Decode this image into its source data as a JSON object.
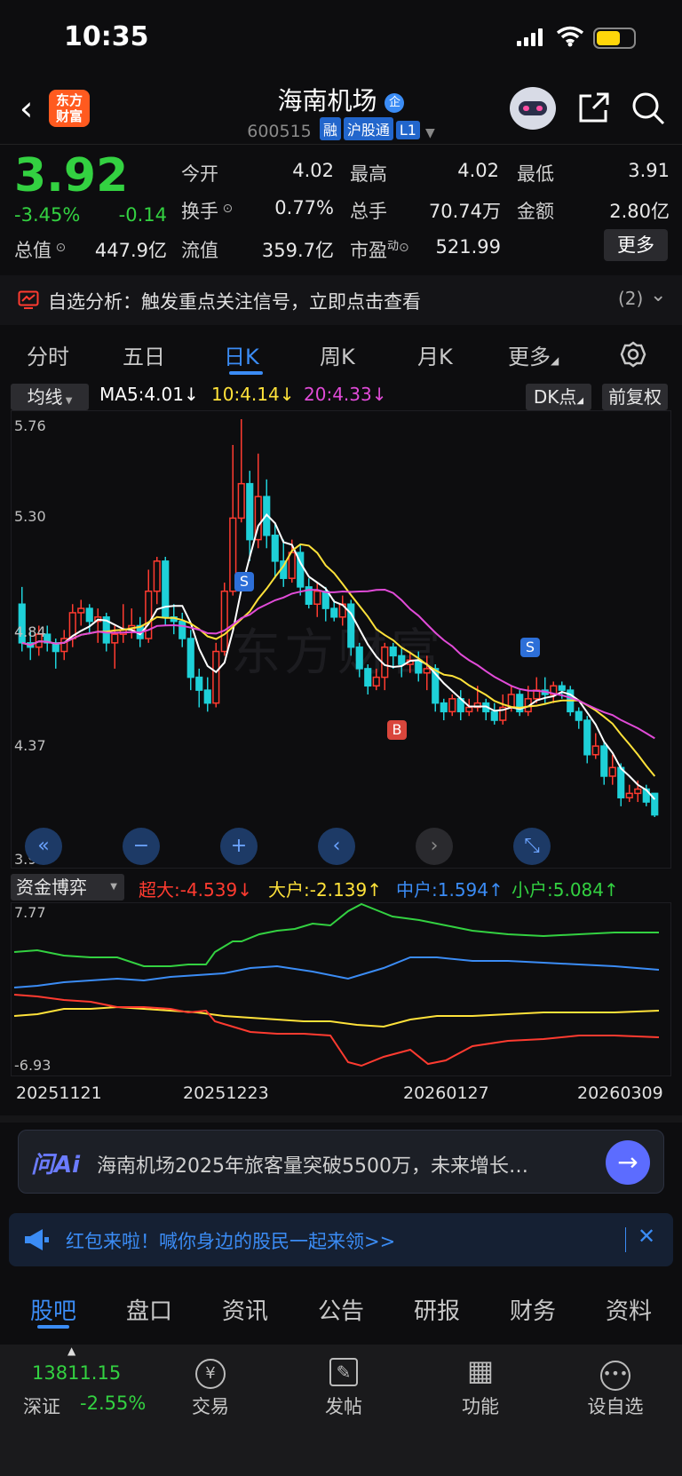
{
  "status_bar": {
    "time": "10:35"
  },
  "header": {
    "title": "海南机场",
    "title_badge": "企",
    "code": "600515",
    "tags": [
      "融",
      "沪股通",
      "L1"
    ],
    "logo_line1": "东方",
    "logo_line2": "财富"
  },
  "quote": {
    "price": "3.92",
    "change_pct": "-3.45%",
    "change": "-0.14",
    "fields": {
      "open_label": "今开",
      "open": "4.02",
      "high_label": "最高",
      "high": "4.02",
      "low_label": "最低",
      "low": "3.91",
      "turnover_label": "换手",
      "turnover": "0.77%",
      "volume_label": "总手",
      "volume": "70.74万",
      "amount_label": "金额",
      "amount": "2.80亿",
      "mcap_label": "总值",
      "mcap": "447.9亿",
      "float_label": "流值",
      "float": "359.7亿",
      "pe_label": "市盈",
      "pe_sup": "动",
      "pe": "521.99"
    },
    "more_label": "更多"
  },
  "banner": {
    "text": "自选分析：触发重点关注信号，立即点击查看",
    "count": "(2)"
  },
  "chart_tabs": [
    "分时",
    "五日",
    "日K",
    "周K",
    "月K",
    "更多"
  ],
  "active_tab": "日K",
  "ma_bar": {
    "selector": "均线",
    "ma5": "MA5:4.01",
    "ma10": "10:4.14",
    "ma20": "20:4.33",
    "dk_label": "DK点",
    "adjust_label": "前复权"
  },
  "price_axis": [
    "5.76",
    "5.30",
    "4.84",
    "4.37",
    "3.91"
  ],
  "markers": {
    "s1": "S",
    "s2": "S",
    "b1": "B"
  },
  "watermark": "东方财富",
  "fund_bar": {
    "selector": "资金博弈",
    "super": "超大:-4.539",
    "large": "大户:-2.139",
    "medium": "中户:1.594",
    "small": "小户:5.084"
  },
  "fund_axis": [
    "7.77",
    "-6.93"
  ],
  "dates": [
    "20251121",
    "20251223",
    "20260127",
    "20260309"
  ],
  "ai": {
    "logo": "问Ai",
    "text": "海南机场2025年旅客量突破5500万，未来增长…"
  },
  "promo": {
    "text": "红包来啦！喊你身边的股民一起来领>>"
  },
  "bottom_tabs": [
    "股吧",
    "盘口",
    "资讯",
    "公告",
    "研报",
    "财务",
    "资料"
  ],
  "bottom_bar": {
    "index_value": "13811.15",
    "index_name": "深证",
    "index_change": "-2.55%",
    "items": [
      "交易",
      "发帖",
      "功能",
      "设自选"
    ]
  },
  "chart_data": {
    "type": "candlestick",
    "ylim": [
      3.91,
      5.76
    ],
    "candles": [
      [
        4.9,
        4.72,
        4.98,
        4.68
      ],
      [
        4.72,
        4.7,
        4.78,
        4.64
      ],
      [
        4.7,
        4.76,
        4.8,
        4.66
      ],
      [
        4.76,
        4.72,
        4.8,
        4.68
      ],
      [
        4.72,
        4.68,
        4.74,
        4.6
      ],
      [
        4.68,
        4.74,
        4.78,
        4.64
      ],
      [
        4.74,
        4.86,
        4.9,
        4.7
      ],
      [
        4.86,
        4.88,
        4.92,
        4.8
      ],
      [
        4.88,
        4.82,
        4.9,
        4.76
      ],
      [
        4.82,
        4.84,
        4.88,
        4.72
      ],
      [
        4.84,
        4.72,
        4.86,
        4.68
      ],
      [
        4.72,
        4.76,
        4.8,
        4.6
      ],
      [
        4.76,
        4.78,
        4.9,
        4.72
      ],
      [
        4.78,
        4.8,
        4.88,
        4.74
      ],
      [
        4.8,
        4.74,
        4.84,
        4.7
      ],
      [
        4.74,
        4.96,
        5.06,
        4.72
      ],
      [
        4.96,
        5.1,
        5.12,
        4.9
      ],
      [
        5.1,
        4.84,
        5.12,
        4.8
      ],
      [
        4.84,
        4.82,
        4.9,
        4.76
      ],
      [
        4.82,
        4.74,
        4.86,
        4.7
      ],
      [
        4.74,
        4.56,
        4.78,
        4.5
      ],
      [
        4.56,
        4.5,
        4.6,
        4.42
      ],
      [
        4.5,
        4.44,
        4.56,
        4.4
      ],
      [
        4.44,
        4.68,
        4.72,
        4.42
      ],
      [
        4.68,
        4.96,
        5.0,
        4.66
      ],
      [
        4.96,
        5.3,
        5.64,
        4.94
      ],
      [
        5.3,
        5.46,
        5.76,
        5.28
      ],
      [
        5.46,
        5.2,
        5.52,
        5.1
      ],
      [
        5.2,
        5.4,
        5.6,
        5.16
      ],
      [
        5.4,
        5.22,
        5.48,
        5.16
      ],
      [
        5.22,
        5.1,
        5.28,
        5.02
      ],
      [
        5.1,
        5.02,
        5.2,
        4.98
      ],
      [
        5.02,
        5.14,
        5.2,
        5.0
      ],
      [
        5.14,
        4.98,
        5.18,
        4.94
      ],
      [
        4.98,
        4.9,
        5.02,
        4.88
      ],
      [
        4.9,
        4.96,
        5.0,
        4.84
      ],
      [
        4.96,
        4.88,
        4.98,
        4.82
      ],
      [
        4.88,
        4.84,
        4.92,
        4.82
      ],
      [
        4.84,
        4.9,
        4.94,
        4.8
      ],
      [
        4.9,
        4.7,
        4.92,
        4.66
      ],
      [
        4.7,
        4.6,
        4.72,
        4.56
      ],
      [
        4.6,
        4.52,
        4.62,
        4.48
      ],
      [
        4.52,
        4.56,
        4.6,
        4.5
      ],
      [
        4.56,
        4.7,
        4.72,
        4.5
      ],
      [
        4.7,
        4.66,
        4.72,
        4.6
      ],
      [
        4.66,
        4.62,
        4.7,
        4.56
      ],
      [
        4.62,
        4.64,
        4.68,
        4.58
      ],
      [
        4.64,
        4.58,
        4.68,
        4.54
      ],
      [
        4.58,
        4.6,
        4.66,
        4.5
      ],
      [
        4.6,
        4.44,
        4.62,
        4.4
      ],
      [
        4.44,
        4.4,
        4.46,
        4.36
      ],
      [
        4.4,
        4.46,
        4.48,
        4.38
      ],
      [
        4.46,
        4.4,
        4.5,
        4.36
      ],
      [
        4.4,
        4.42,
        4.46,
        4.38
      ],
      [
        4.42,
        4.44,
        4.52,
        4.4
      ],
      [
        4.44,
        4.4,
        4.46,
        4.36
      ],
      [
        4.4,
        4.36,
        4.44,
        4.34
      ],
      [
        4.36,
        4.42,
        4.48,
        4.34
      ],
      [
        4.42,
        4.48,
        4.52,
        4.4
      ],
      [
        4.48,
        4.4,
        4.5,
        4.38
      ],
      [
        4.4,
        4.46,
        4.52,
        4.38
      ],
      [
        4.46,
        4.5,
        4.56,
        4.44
      ],
      [
        4.5,
        4.48,
        4.56,
        4.44
      ],
      [
        4.48,
        4.52,
        4.54,
        4.44
      ],
      [
        4.52,
        4.5,
        4.54,
        4.46
      ],
      [
        4.5,
        4.4,
        4.52,
        4.38
      ],
      [
        4.4,
        4.36,
        4.42,
        4.32
      ],
      [
        4.36,
        4.2,
        4.38,
        4.16
      ],
      [
        4.2,
        4.24,
        4.3,
        4.18
      ],
      [
        4.24,
        4.1,
        4.26,
        4.06
      ],
      [
        4.1,
        4.14,
        4.2,
        4.06
      ],
      [
        4.14,
        4.0,
        4.16,
        3.96
      ],
      [
        4.0,
        4.02,
        4.06,
        3.98
      ],
      [
        4.02,
        4.04,
        4.08,
        3.98
      ],
      [
        4.04,
        3.98,
        4.06,
        3.96
      ],
      [
        4.02,
        3.92,
        4.02,
        3.91
      ]
    ]
  }
}
